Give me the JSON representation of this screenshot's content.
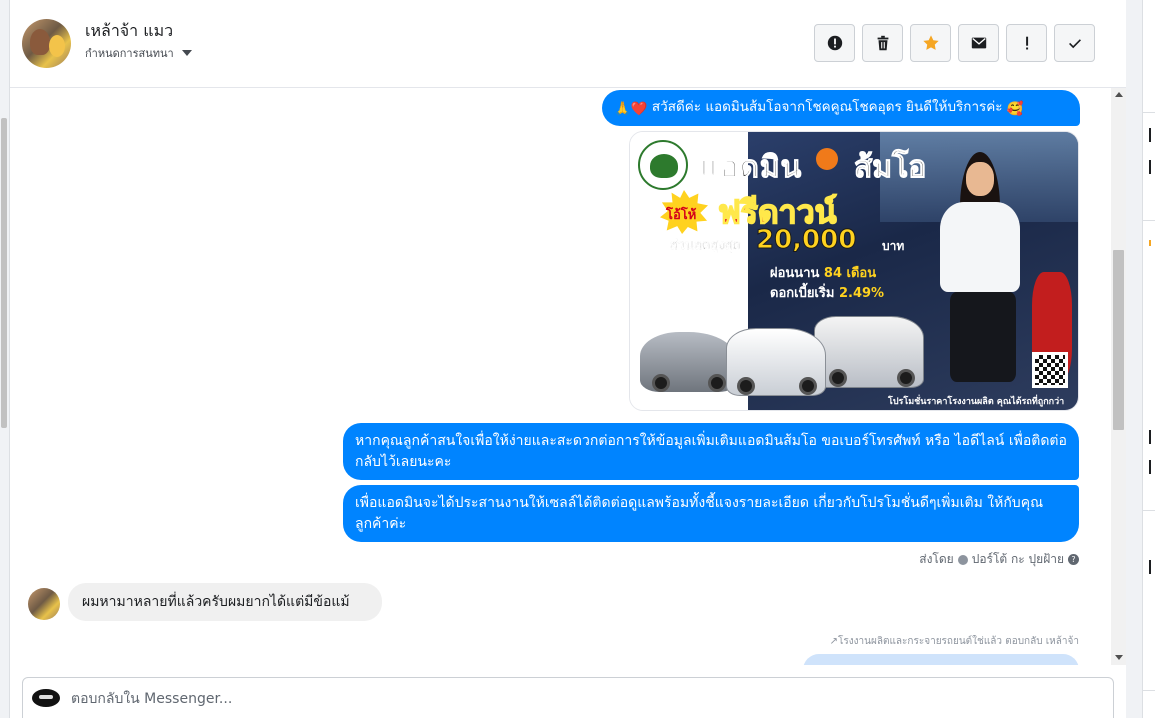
{
  "header": {
    "contact_name": "เหล้าจ้า แมว",
    "conversation_status": "กำหนดการสนทนา",
    "actions": [
      {
        "name": "report-icon",
        "label": "report"
      },
      {
        "name": "trash-icon",
        "label": "delete"
      },
      {
        "name": "star-icon",
        "label": "star"
      },
      {
        "name": "mail-icon",
        "label": "mark as unread"
      },
      {
        "name": "exclamation-icon",
        "label": "spam"
      },
      {
        "name": "check-icon",
        "label": "done"
      }
    ]
  },
  "messages": {
    "greeting": "สวัสดีค่ะ แอดมินส้มโอจากโชคคูณโชคอุดร ยินดีให้บริการค่ะ",
    "greeting_prefix_emoji": "🙏❤️",
    "greeting_suffix_emoji": "🥰",
    "promo": {
      "title_left": "แอดมิน",
      "title_right": "ส้มโอ",
      "badge": "โอ้โห้",
      "headline": "ฟรีดาวน์",
      "discount_label": "ส่วนลดสูงสุด",
      "discount_amount": "20,000",
      "currency": "บาท",
      "installment_prefix": "ผ่อนนาน",
      "installment_value": "84 เดือน",
      "interest_prefix": "ดอกเบี้ยเริ่ม",
      "interest_value": "2.49%",
      "footer": "โปรโมชั่นราคาโรงงานผลิต คุณได้รถที่ถูกกว่า"
    },
    "info_request": "หากคุณลูกค้าสนใจเพื่อให้ง่ายและสะดวกต่อการให้ข้อมูลเพิ่มเติมแอดมินส้มโอ ขอเบอร์โทรศัพท์ หรือ ไอดีไลน์ เพื่อติดต่อกลับไว้เลยนะคะ",
    "coordination": "เพื่อแอดมินจะได้ประสานงานให้เซลล์ได้ติดต่อดูแลพร้อมทั้งชี้แจงรายละเอียด เกี่ยวกับโปรโมชั่นดีๆเพิ่มเติม ให้กับคุณลูกค้าค่ะ",
    "sent_by": "ส่งโดย",
    "sender_name": "ปอร์โต้ กะ ปุยฝ้าย",
    "incoming": "ผมหามาหลายที่แล้วครับผมยากได้แต่มีข้อแม้",
    "reply_reference": "↗โรงงานผลิตและกระจายรถยนต์ใช่แล้ว ตอบกลับ เหล้าจ้า"
  },
  "composer": {
    "placeholder": "ตอบกลับใน Messenger..."
  },
  "colors": {
    "outgoing_bubble": "#0084ff",
    "incoming_bubble": "#f0f0f0",
    "star": "#f5a623"
  }
}
